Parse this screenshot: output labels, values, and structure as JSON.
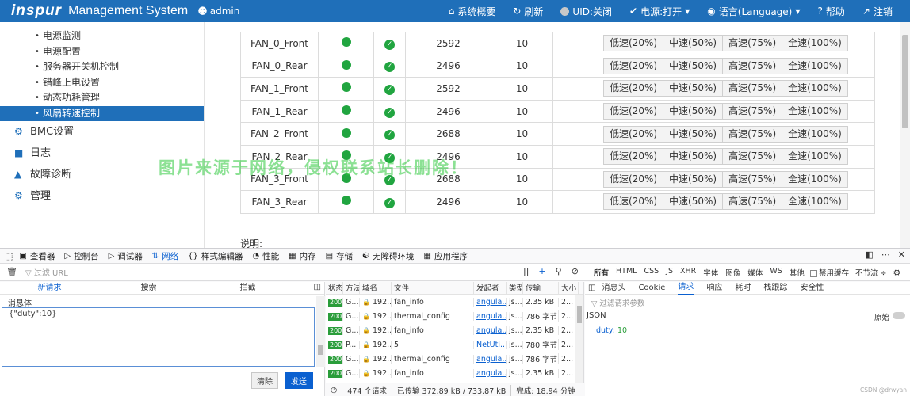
{
  "topbar": {
    "logo": "inspur",
    "title": "Management System",
    "user": "admin",
    "items": [
      {
        "icon": "home-icon",
        "label": "系统概要"
      },
      {
        "icon": "refresh-icon",
        "label": "刷新"
      },
      {
        "icon": "uid-icon",
        "label": "UID:关闭"
      },
      {
        "icon": "check-icon",
        "label": "电源:打开"
      },
      {
        "icon": "globe-icon",
        "label": "语言(Language)"
      },
      {
        "icon": "help-icon",
        "label": "帮助"
      },
      {
        "icon": "logout-icon",
        "label": "注销"
      }
    ]
  },
  "sidebar": {
    "sub_items": [
      "电源监测",
      "电源配置",
      "服务器开关机控制",
      "错峰上电设置",
      "动态功耗管理",
      "风扇转速控制"
    ],
    "main_items": [
      {
        "icon": "gear-icon",
        "label": "BMC设置"
      },
      {
        "icon": "log-icon",
        "label": "日志"
      },
      {
        "icon": "warning-icon",
        "label": "故障诊断"
      },
      {
        "icon": "cog-icon",
        "label": "管理"
      }
    ]
  },
  "fans": [
    {
      "name": "FAN_0_Front",
      "rpm": "2592",
      "duty": "10"
    },
    {
      "name": "FAN_0_Rear",
      "rpm": "2496",
      "duty": "10"
    },
    {
      "name": "FAN_1_Front",
      "rpm": "2592",
      "duty": "10"
    },
    {
      "name": "FAN_1_Rear",
      "rpm": "2496",
      "duty": "10"
    },
    {
      "name": "FAN_2_Front",
      "rpm": "2688",
      "duty": "10"
    },
    {
      "name": "FAN_2_Rear",
      "rpm": "2496",
      "duty": "10"
    },
    {
      "name": "FAN_3_Front",
      "rpm": "2688",
      "duty": "10"
    },
    {
      "name": "FAN_3_Rear",
      "rpm": "2496",
      "duty": "10"
    }
  ],
  "speed_buttons": [
    "低速(20%)",
    "中速(50%)",
    "高速(75%)",
    "全速(100%)"
  ],
  "note": "说明:",
  "watermark": "图片来源于网络，侵权联系站长删除！",
  "devtools": {
    "tabs": [
      {
        "icon": "inspector-icon",
        "label": "查看器"
      },
      {
        "icon": "console-icon",
        "label": "控制台"
      },
      {
        "icon": "debugger-icon",
        "label": "调试器"
      },
      {
        "icon": "network-icon",
        "label": "网络"
      },
      {
        "icon": "style-icon",
        "label": "样式编辑器"
      },
      {
        "icon": "perf-icon",
        "label": "性能"
      },
      {
        "icon": "memory-icon",
        "label": "内存"
      },
      {
        "icon": "storage-icon",
        "label": "存储"
      },
      {
        "icon": "a11y-icon",
        "label": "无障碍环境"
      },
      {
        "icon": "apps-icon",
        "label": "应用程序"
      }
    ],
    "filter_placeholder": "过滤 URL",
    "types": [
      "所有",
      "HTML",
      "CSS",
      "JS",
      "XHR",
      "字体",
      "图像",
      "媒体",
      "WS",
      "其他"
    ],
    "disable_cache": "禁用缓存",
    "throttle": "不节流 ÷",
    "left_tabs": [
      "新请求",
      "搜索",
      "拦截"
    ],
    "body_label": "消息体",
    "body_value": "{\"duty\":10}",
    "clear_btn": "清除",
    "send_btn": "发送",
    "req_headers": [
      "状态",
      "方法",
      "域名",
      "文件",
      "发起者",
      "类型",
      "传输",
      "大小"
    ],
    "requests": [
      {
        "status": "200",
        "method": "G...",
        "domain": "192....",
        "file": "fan_info",
        "initiator": "angula...",
        "type": "js...",
        "transfer": "2.35 kB",
        "size": "2..."
      },
      {
        "status": "200",
        "method": "G...",
        "domain": "192....",
        "file": "thermal_config",
        "initiator": "angula...",
        "type": "js...",
        "transfer": "786 字节",
        "size": "2..."
      },
      {
        "status": "200",
        "method": "G...",
        "domain": "192....",
        "file": "fan_info",
        "initiator": "angula...",
        "type": "js...",
        "transfer": "2.35 kB",
        "size": "2..."
      },
      {
        "status": "200",
        "method": "P...",
        "domain": "192....",
        "file": "5",
        "initiator": "NetUti...",
        "type": "js...",
        "transfer": "780 字节",
        "size": "2..."
      },
      {
        "status": "200",
        "method": "G...",
        "domain": "192....",
        "file": "thermal_config",
        "initiator": "angula...",
        "type": "js...",
        "transfer": "786 字节",
        "size": "2..."
      },
      {
        "status": "200",
        "method": "G...",
        "domain": "192....",
        "file": "fan_info",
        "initiator": "angula...",
        "type": "js...",
        "transfer": "2.35 kB",
        "size": "2..."
      }
    ],
    "stats": [
      "474 个请求",
      "已传输 372.89 kB / 733.87 kB",
      "完成: 18.94 分钟"
    ],
    "right_tabs": [
      "消息头",
      "Cookie",
      "请求",
      "响应",
      "耗时",
      "栈跟踪",
      "安全性"
    ],
    "param_filter": "过滤请求参数",
    "json_label": "JSON",
    "raw_label": "原始",
    "param_key": "duty:",
    "param_value": "10",
    "credit": "CSDN @drwyan"
  }
}
